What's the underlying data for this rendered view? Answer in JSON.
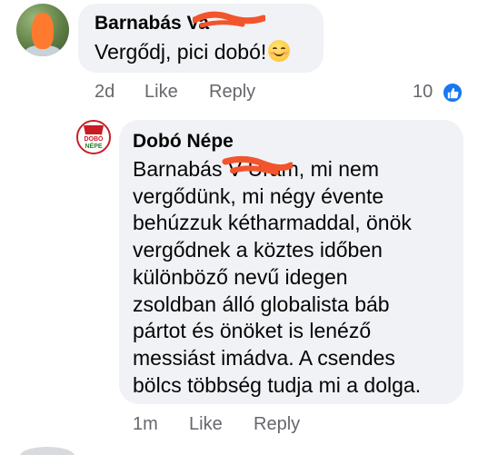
{
  "comments": [
    {
      "author": "Barnabás Vajda",
      "author_visible": "Barnabás Va",
      "text": "Vergődj, pici dobó!",
      "emoji": "smiling-face-icon",
      "time": "2d",
      "like_label": "Like",
      "reply_label": "Reply",
      "reaction_count": "10",
      "reaction_icon": "thumbs-up-icon"
    }
  ],
  "reply": {
    "author": "Dobó Népe",
    "avatar_text": "DOBÓ NÉPE",
    "text_lines": [
      "Barnabás V Uram, mi nem",
      "vergődünk, mi négy évente",
      "behúzzuk kétharmaddal, önök",
      "vergődnek a köztes időben",
      "különböző nevű idegen",
      "zsoldban álló globalista báb",
      "pártot és önöket is lenéző",
      "messiást imádva. A csendes",
      "bölcs többség tudja mi a dolga."
    ],
    "time": "1m",
    "like_label": "Like",
    "reply_label": "Reply"
  },
  "colors": {
    "bubble": "#f0f2f5",
    "meta_text": "#65676b",
    "like_blue": "#1877f2",
    "redaction": "#f2552c"
  }
}
